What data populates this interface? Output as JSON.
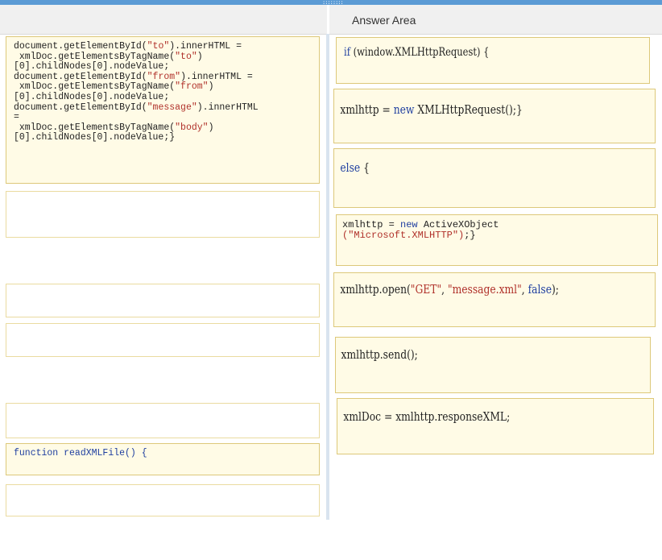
{
  "answer_area": {
    "title": "Answer Area"
  },
  "source_items": {
    "item1": {
      "l1_a": "document.getElementById(",
      "l1_s": "\"to\"",
      "l1_b": ").innerHTML =",
      "l2_a": " xmlDoc.getElementsByTagName(",
      "l2_s": "\"to\"",
      "l2_b": ")",
      "l3": "[0].childNodes[0].nodeValue;",
      "l4_a": "document.getElementById(",
      "l4_s": "\"from\"",
      "l4_b": ").innerHTML =",
      "l5_a": " xmlDoc.getElementsByTagName(",
      "l5_s": "\"from\"",
      "l5_b": ")",
      "l6": "[0].childNodes[0].nodeValue;",
      "l7_a": "document.getElementById(",
      "l7_s": "\"message\"",
      "l7_b": ").innerHTML",
      "l8": "=",
      "l9_a": " xmlDoc.getElementsByTagName(",
      "l9_s": "\"body\"",
      "l9_b": ")",
      "l10": "[0].childNodes[0].nodeValue;}"
    },
    "item_func": {
      "text": "function readXMLFile() {"
    }
  },
  "answer_items": {
    "if": {
      "kw": "if",
      "rest": " (window.XMLHttpRequest) {"
    },
    "new_xhr": {
      "a": "xmlhttp = ",
      "kw": "new",
      "b": " XMLHttpRequest();}"
    },
    "else": {
      "kw": "else",
      "b": " {"
    },
    "activex": {
      "a": "xmlhttp = ",
      "kw": "new",
      "b": " ActiveXObject",
      "s": "(\"Microsoft.XMLHTTP\")",
      "c": ";}"
    },
    "open": {
      "a": "xmlhttp.open(",
      "s1": "\"GET\"",
      "sep1": ", ",
      "s2": "\"message.xml\"",
      "sep2": ", ",
      "kw": "false",
      "b": ");"
    },
    "send": {
      "text": "xmlhttp.send();"
    },
    "response": {
      "text": "xmlDoc = xmlhttp.responseXML;"
    }
  }
}
